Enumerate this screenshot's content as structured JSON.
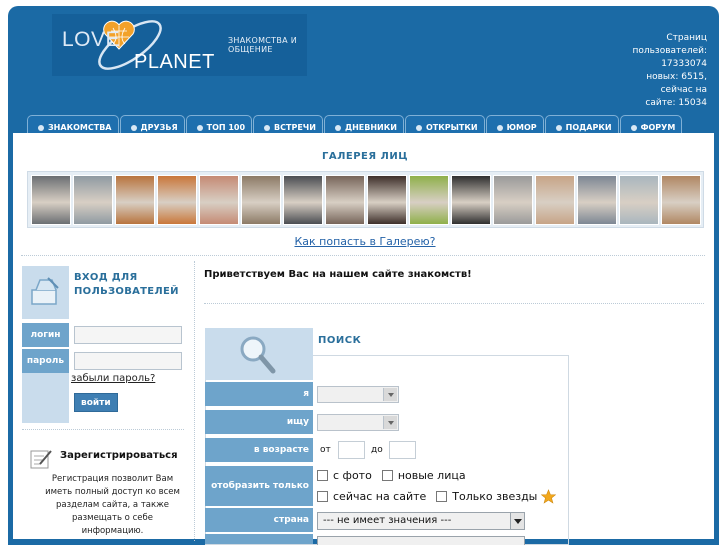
{
  "header": {
    "logo_love": "LOVE",
    "logo_planet": "PLANET",
    "tagline": "ЗНАКОМСТВА И ОБЩЕНИЕ",
    "stats": [
      "Страниц",
      "пользователей:",
      "17333074",
      "новых: 6515,",
      "сейчас на",
      "сайте: 15034"
    ]
  },
  "tabs": [
    "ЗНАКОМСТВА",
    "ДРУЗЬЯ",
    "ТОП 100",
    "ВСТРЕЧИ",
    "ДНЕВНИКИ",
    "ОТКРЫТКИ",
    "ЮМОР",
    "ПОДАРКИ",
    "ФОРУМ"
  ],
  "gallery": {
    "title": "ГАЛЕРЕЯ ЛИЦ",
    "link": "Как попасть в Галерею?",
    "photo_colors": [
      "#6b6f73",
      "#8f9aa2",
      "#b8743e",
      "#c9773a",
      "#c58a74",
      "#8c7a66",
      "#4a4d52",
      "#77655a",
      "#3d2f2a",
      "#8fb04a",
      "#2f2f2f",
      "#9a9a9a",
      "#c7a487",
      "#7d8794",
      "#a9b6be",
      "#b08763"
    ]
  },
  "login": {
    "title": "ВХОД ДЛЯ ПОЛЬЗОВАТЕЛЕЙ",
    "login_label": "логин",
    "password_label": "пароль",
    "forgot": "забыли пароль?",
    "button": "войти"
  },
  "register": {
    "link": "Зарегистрироваться",
    "text": "Регистрация позволит Вам иметь полный доступ ко всем разделам сайта, а также размещать о себе информацию."
  },
  "welcome": "Приветствуем Вас на нашем сайте знакомств!",
  "search": {
    "title": "ПОИСК",
    "labels": {
      "i_am": "я",
      "seek": "ищу",
      "age": "в возрасте",
      "show_only": "отобразить только",
      "country": "страна"
    },
    "age_from": "от",
    "age_to": "до",
    "checks": {
      "with_photo": "с фото",
      "new_faces": "новые лица",
      "online": "сейчас на сайте",
      "stars_only": "Только звезды"
    },
    "country_value": "--- не имеет значения ---"
  }
}
